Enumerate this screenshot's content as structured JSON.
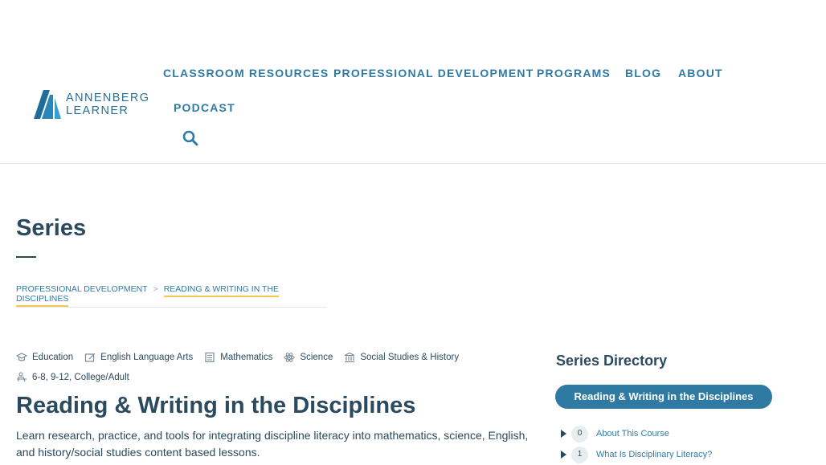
{
  "brand": {
    "line1": "ANNENBERG",
    "line2": "LEARNER",
    "color": "#2a6f95"
  },
  "nav": {
    "items": [
      "CLASSROOM RESOURCES",
      "PROFESSIONAL DEVELOPMENT",
      "PROGRAMS",
      "BLOG",
      "ABOUT",
      "PODCAST"
    ],
    "search_icon": "search-icon"
  },
  "page": {
    "title": "Series"
  },
  "breadcrumb": {
    "parent": "PROFESSIONAL DEVELOPMENT",
    "separator": ">",
    "current": "READING & WRITING IN THE DISCIPLINES"
  },
  "subjects": [
    "Education",
    "English Language Arts",
    "Mathematics",
    "Science",
    "Social Studies & History"
  ],
  "grades": "6-8, 9-12, College/Adult",
  "series": {
    "title": "Reading & Writing in the Disciplines",
    "description": "Learn research, practice, and tools for integrating discipline literacy into mathematics, science, English, and history/social studies content based lessons."
  },
  "directory": {
    "heading": "Series Directory",
    "selected": "Reading & Writing in the Disciplines",
    "items": [
      {
        "num": "0",
        "label": "About This Course"
      },
      {
        "num": "1",
        "label": "What Is Disciplinary Literacy?"
      }
    ]
  },
  "colors": {
    "accent": "#2f7aa3",
    "text": "#2b4a5e",
    "highlight": "#f2c94c"
  }
}
